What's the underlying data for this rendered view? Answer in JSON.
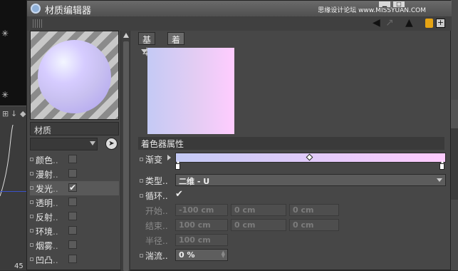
{
  "window": {
    "title": "材质编辑器",
    "watermark": "思缘设计论坛 www.MISSYUAN.COM"
  },
  "background": {
    "frame_number": "45"
  },
  "material": {
    "name": "材质",
    "preview_colors": {
      "start": "#c4caf5",
      "end": "#ffccff"
    }
  },
  "channels": [
    {
      "label": "颜色",
      "checked": false
    },
    {
      "label": "漫射",
      "checked": false
    },
    {
      "label": "发光",
      "checked": true
    },
    {
      "label": "透明",
      "checked": false
    },
    {
      "label": "反射",
      "checked": false
    },
    {
      "label": "环境",
      "checked": false
    },
    {
      "label": "烟雾",
      "checked": false
    },
    {
      "label": "凹凸",
      "checked": false
    }
  ],
  "tabs": [
    {
      "label": "基本",
      "active": false
    },
    {
      "label": "着色器",
      "active": true
    }
  ],
  "shader": {
    "section_title": "着色器属性",
    "gradient_label": "渐变",
    "type_label": "类型",
    "type_value": "二维 - U",
    "cycle_label": "循环",
    "cycle_checked": true,
    "start_label": "开始",
    "start_values": [
      "-100 cm",
      "0 cm",
      "0 cm"
    ],
    "end_label": "结束",
    "end_values": [
      "100 cm",
      "0 cm",
      "0 cm"
    ],
    "radius_label": "半径",
    "radius_value": "100 cm",
    "turbulence_label": "湍流",
    "turbulence_value": "0 %"
  }
}
